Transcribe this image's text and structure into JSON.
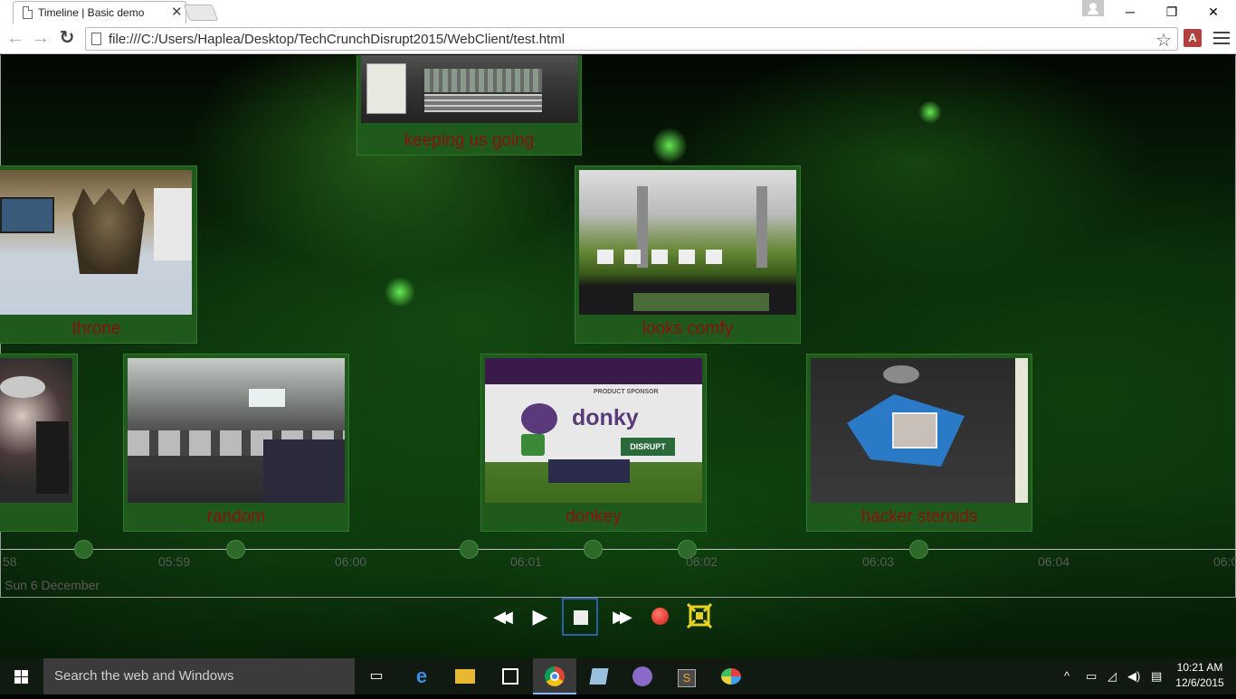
{
  "browser": {
    "tab_title": "Timeline | Basic demo",
    "tab_close": "✕",
    "url": "file:///C:/Users/Haplea/Desktop/TechCrunchDisrupt2015/WebClient/test.html",
    "minimize": "─",
    "restore": "❐",
    "close": "✕",
    "back": "←",
    "forward": "→",
    "reload": "↻",
    "star": "☆",
    "ext_label": "A"
  },
  "timeline": {
    "cards": [
      {
        "label": "keeping us going",
        "photo": "kitchen-counter"
      },
      {
        "label": "throne",
        "photo": "iron-throne"
      },
      {
        "label": "looks comfy",
        "photo": "stage-chairs"
      },
      {
        "label": "",
        "photo": "audience-partial"
      },
      {
        "label": "random",
        "photo": "conference-hall"
      },
      {
        "label": "donkey",
        "photo": "donky-sign",
        "sign_text": "donky",
        "sponsor_text": "PRODUCT SPONSOR",
        "banner_text": "DISRUPT"
      },
      {
        "label": "hacker steroids",
        "photo": "snack-bag"
      }
    ],
    "ticks": [
      "58",
      "05:59",
      "06:00",
      "06:01",
      "06:02",
      "06:03",
      "06:04",
      "06:0"
    ],
    "date": "Sun 6 December"
  },
  "controls": {
    "rewind": "◀◀",
    "play": "▶",
    "forward": "▶▶",
    "fit": "fit-icon"
  },
  "taskbar": {
    "search_placeholder": "Search the web and Windows",
    "time": "10:21 AM",
    "date": "12/6/2015",
    "tray_up": "^"
  }
}
